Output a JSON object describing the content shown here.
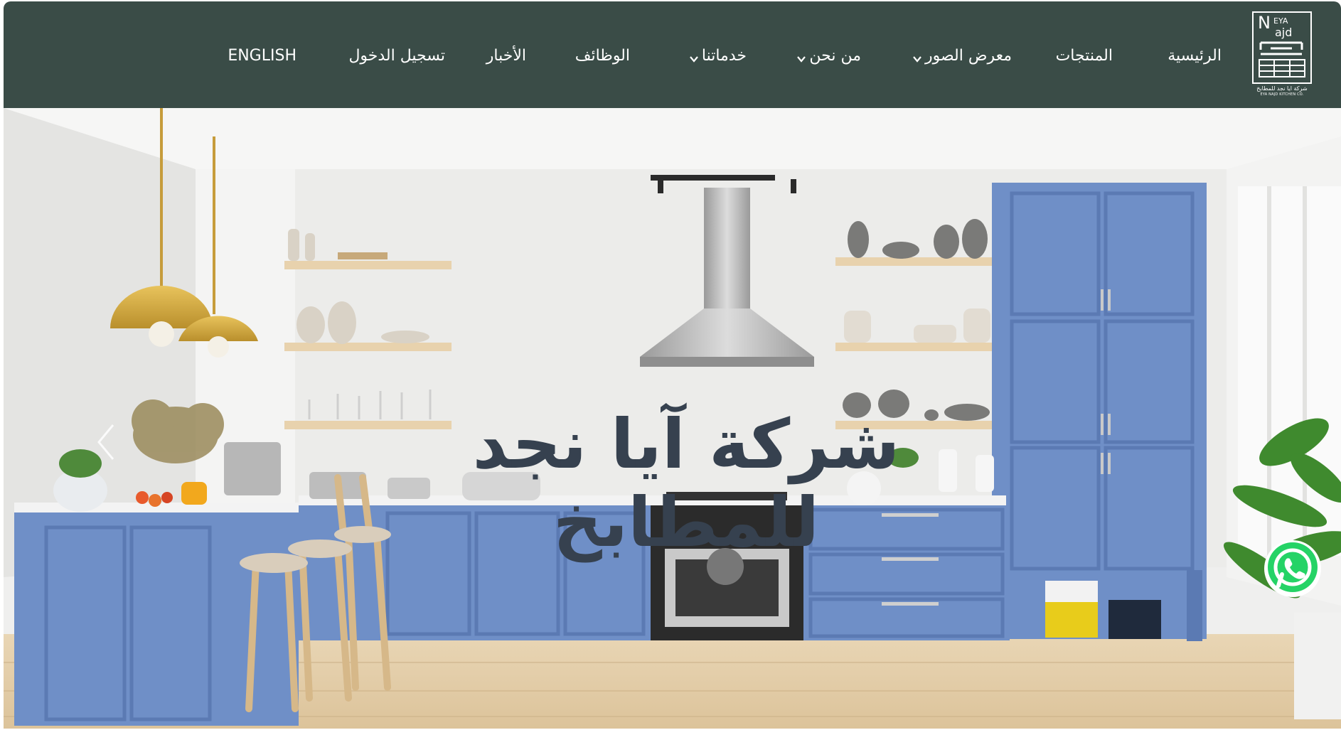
{
  "logo": {
    "latin": "EYA Najd",
    "arabic_name": "شركة ايا نجد للمطابخ",
    "english_name": "EYA NAJD KITCHEN CO."
  },
  "nav": {
    "home": "الرئيسية",
    "products": "المنتجات",
    "gallery": "معرض الصور",
    "about": "من نحن",
    "services": "خدماتنا",
    "jobs": "الوظائف",
    "news": "الأخبار",
    "login": "تسجيل الدخول",
    "language": "ENGLISH"
  },
  "hero": {
    "title": "شركة آيا نجد للمطابخ"
  },
  "colors": {
    "header_bg": "#3a4c47",
    "hero_title": "#36414f",
    "cabinet_blue": "#6f8fc7",
    "whatsapp_green": "#25d366"
  },
  "icons": {
    "nav_dropdown": "chevron-down-icon",
    "carousel_prev": "chevron-left-icon",
    "whatsapp": "whatsapp-icon"
  }
}
